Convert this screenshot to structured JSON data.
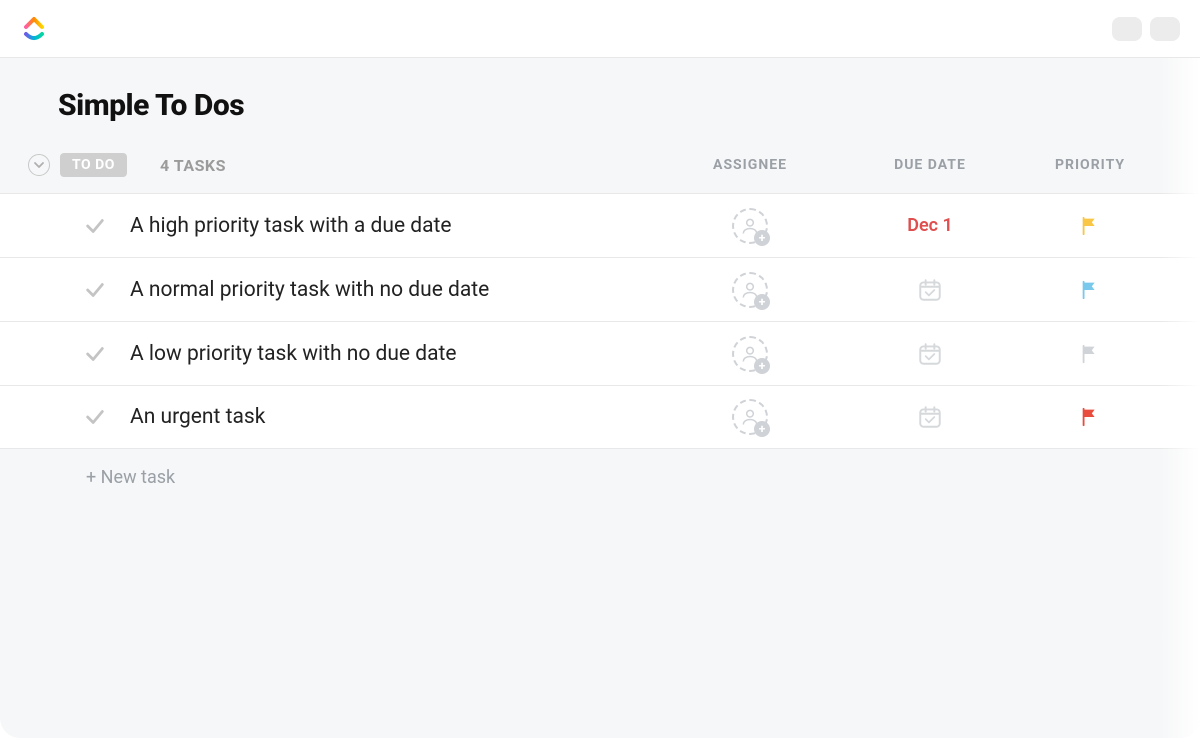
{
  "list": {
    "title": "Simple To Dos",
    "status_chip": "TO DO",
    "task_count_label": "4 TASKS",
    "new_task_label": "+ New task"
  },
  "columns": {
    "assignee": "ASSIGNEE",
    "due_date": "DUE DATE",
    "priority": "PRIORITY"
  },
  "tasks": [
    {
      "name": "A high priority task with a due date",
      "due_label": "Dec 1",
      "due_overdue": true,
      "priority": "high",
      "priority_color": "#f9c645"
    },
    {
      "name": "A normal priority task with no due date",
      "due_label": "",
      "due_overdue": false,
      "priority": "normal",
      "priority_color": "#7ac8eb"
    },
    {
      "name": "A low priority task with no due date",
      "due_label": "",
      "due_overdue": false,
      "priority": "low",
      "priority_color": "#d0d4d9"
    },
    {
      "name": "An urgent task",
      "due_label": "",
      "due_overdue": false,
      "priority": "urgent",
      "priority_color": "#e94b3c"
    }
  ]
}
